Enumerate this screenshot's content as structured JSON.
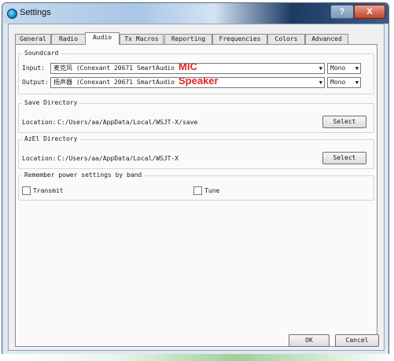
{
  "window": {
    "title": "Settings",
    "help_label": "?",
    "close_label": "X"
  },
  "tabs": [
    {
      "label": "General"
    },
    {
      "label": "Radio"
    },
    {
      "label": "Audio"
    },
    {
      "label": "Tx Macros"
    },
    {
      "label": "Reporting"
    },
    {
      "label": "Frequencies"
    },
    {
      "label": "Colors"
    },
    {
      "label": "Advanced"
    }
  ],
  "soundcard": {
    "title": "Soundcard",
    "input_label": "Input:",
    "input_value": "麦克风 (Conexant 20671 SmartAudio",
    "input_annotation": "MIC",
    "input_channel": "Mono",
    "output_label": "Output:",
    "output_value": "扬声器 (Conexant 20671 SmartAudio",
    "output_annotation": "Speaker",
    "output_channel": "Mono"
  },
  "save_directory": {
    "title": "Save Directory",
    "location_label": "Location:",
    "path": "C:/Users/aa/AppData/Local/WSJT-X/save",
    "button": "Select"
  },
  "azel_directory": {
    "title": "AzEl Directory",
    "location_label": "Location:",
    "path": "C:/Users/aa/AppData/Local/WSJT-X",
    "button": "Select"
  },
  "power": {
    "title": "Remember power settings by band",
    "transmit_label": "Transmit",
    "tune_label": "Tune"
  },
  "footer": {
    "ok": "OK",
    "cancel": "Cancel"
  },
  "colors": {
    "annotation": "#e32222",
    "title_dark": "#1d3a63"
  }
}
